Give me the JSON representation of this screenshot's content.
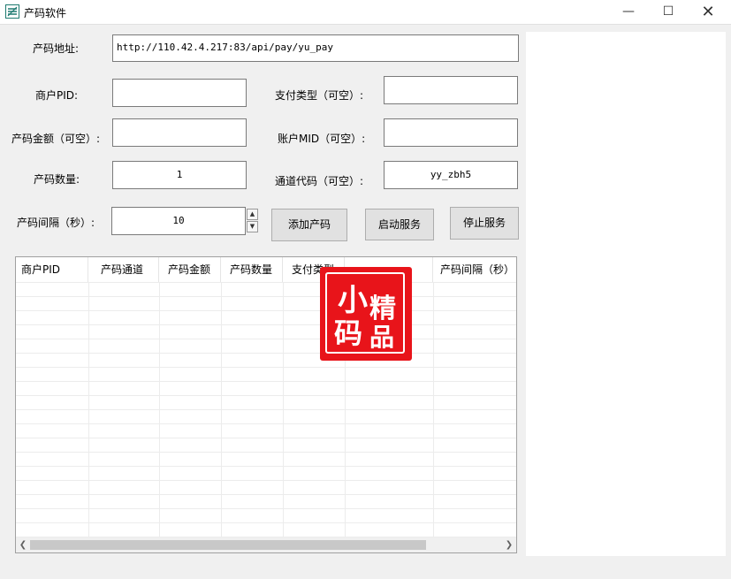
{
  "window": {
    "title": "产码软件"
  },
  "form": {
    "url_label": "产码地址:",
    "url_value": "http://110.42.4.217:83/api/pay/yu_pay",
    "pid_label": "商户PID:",
    "pid_value": "",
    "paytype_label": "支付类型（可空）:",
    "paytype_value": "",
    "amount_label": "产码金额（可空）:",
    "amount_value": "",
    "mid_label": "账户MID（可空）:",
    "mid_value": "",
    "count_label": "产码数量:",
    "count_value": "1",
    "channel_label": "通道代码（可空）:",
    "channel_value": "yy_zbh5",
    "interval_label": "产码间隔（秒）:",
    "interval_value": "10"
  },
  "buttons": {
    "add": "添加产码",
    "start": "启动服务",
    "stop": "停止服务"
  },
  "table": {
    "columns": [
      "商户PID",
      "产码通道",
      "产码金额",
      "产码数量",
      "支付类型",
      "",
      "产码间隔（秒）"
    ]
  },
  "stamp": {
    "chars": [
      "小",
      "码",
      "精",
      "品"
    ],
    "color": "#e8141a"
  }
}
